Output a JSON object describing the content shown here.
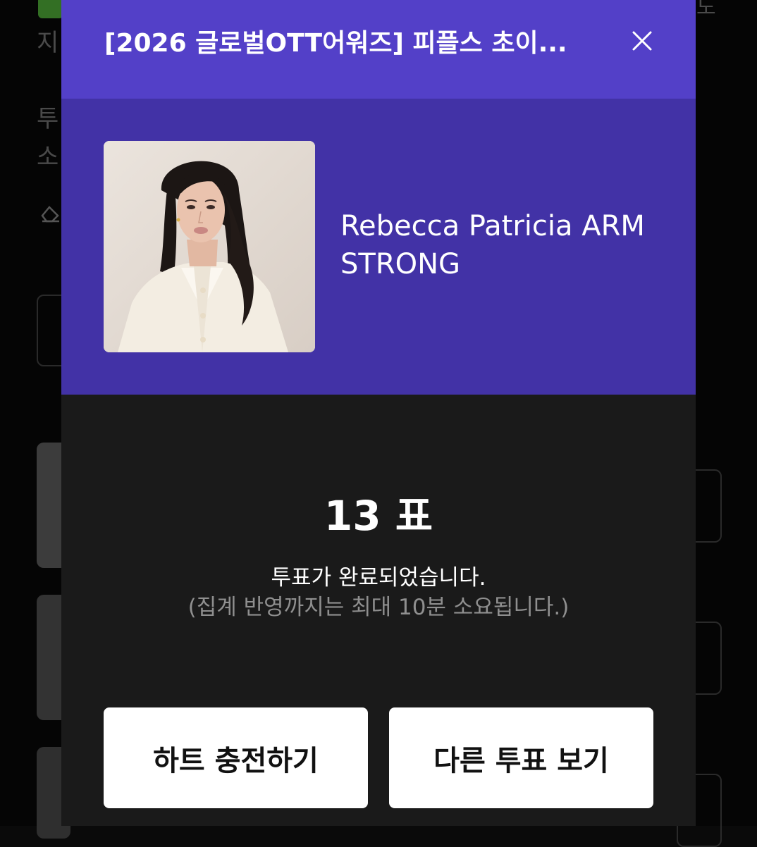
{
  "background": {
    "line1": "지",
    "line2": "투",
    "line3": "소",
    "corner": "도"
  },
  "modal": {
    "title": "[2026 글로벌OTT어워즈] 피플스 초이...",
    "close_icon": "close-icon",
    "header_color": "#5340c8",
    "card_color": "#4232a6"
  },
  "candidate": {
    "name": "Rebecca Patricia ARMSTRONG",
    "photo_icon": "candidate-photo"
  },
  "result": {
    "vote_count": "13 표",
    "complete_message": "투표가 완료되었습니다.",
    "note": "(집계 반영까지는 최대 10분 소요됩니다.)"
  },
  "actions": {
    "charge_hearts": "하트 충전하기",
    "other_votes": "다른 투표 보기"
  }
}
